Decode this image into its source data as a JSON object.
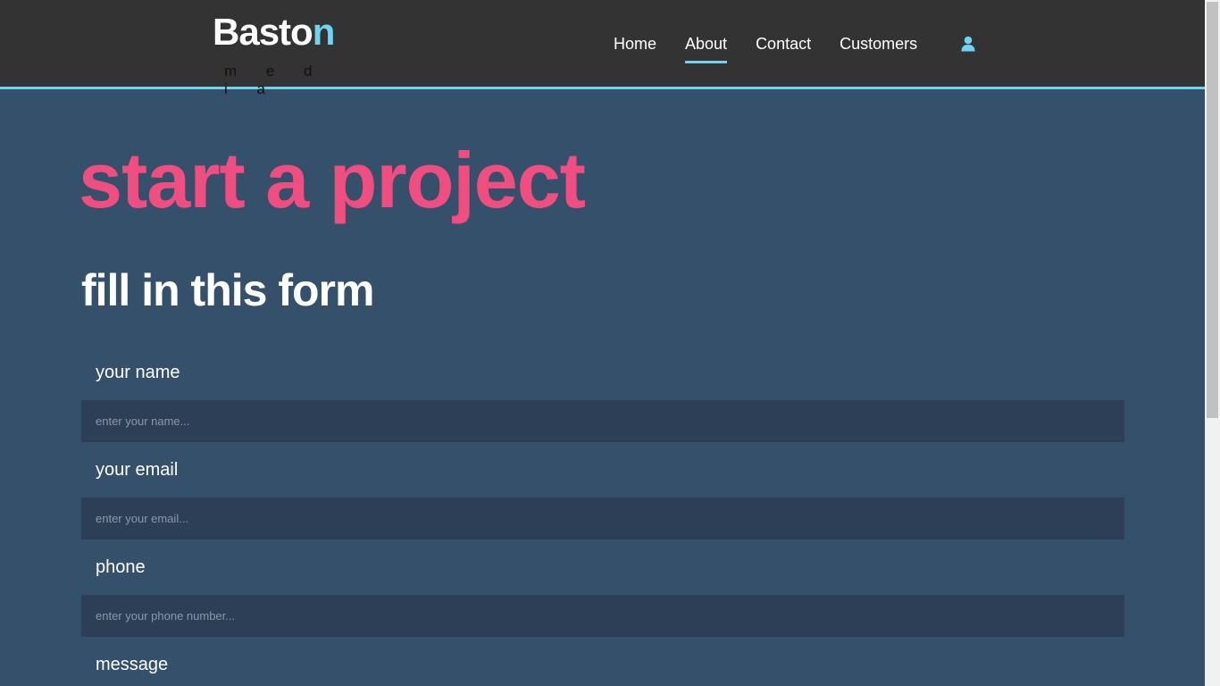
{
  "header": {
    "logo": {
      "word_main": "Basto",
      "word_accent": "n",
      "subtitle": "m e d i a"
    },
    "nav": [
      {
        "label": "Home"
      },
      {
        "label": "About",
        "active": true
      },
      {
        "label": "Contact"
      },
      {
        "label": "Customers"
      }
    ],
    "user_icon": "user-icon"
  },
  "main": {
    "hero_title": "start a project",
    "sub_title": "fill in this form",
    "fields": [
      {
        "label": "your name",
        "placeholder": "enter your name...",
        "value": ""
      },
      {
        "label": "your email",
        "placeholder": "enter your email...",
        "value": ""
      },
      {
        "label": "phone",
        "placeholder": "enter your phone number...",
        "value": ""
      },
      {
        "label": "message"
      }
    ]
  },
  "colors": {
    "header_bg": "#333333",
    "accent": "#6fd3f2",
    "page_bg": "#35506b",
    "hero": "#f04e80",
    "input_bg": "#2d3f57"
  }
}
